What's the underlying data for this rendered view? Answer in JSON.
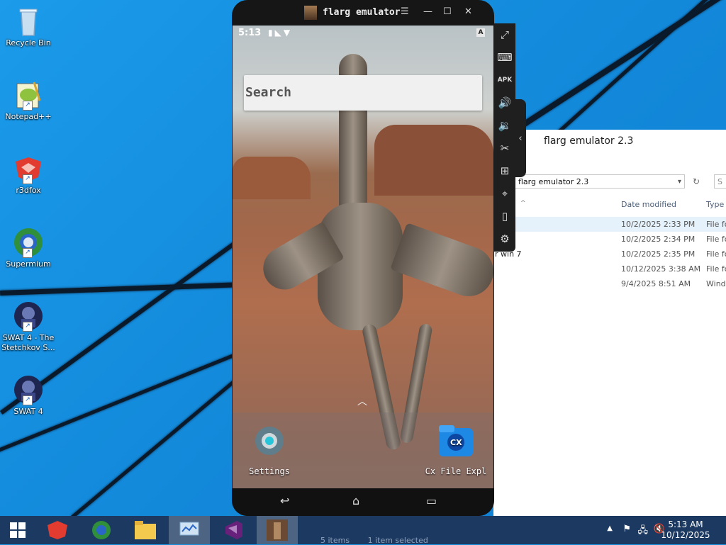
{
  "desktop": {
    "icons": [
      {
        "label": "Recycle Bin"
      },
      {
        "label": "Notepad++"
      },
      {
        "label": "r3dfox"
      },
      {
        "label": "Supermium"
      },
      {
        "label": "SWAT 4 - The Stetchkov S..."
      },
      {
        "label": "SWAT 4"
      }
    ]
  },
  "explorer": {
    "title": "flarg emulator 2.3",
    "address": "flarg emulator 2.3",
    "search_placeholder": "S",
    "columns": {
      "date": "Date modified",
      "type": "Type"
    },
    "rows": [
      {
        "name": "",
        "date": "10/2/2025 2:33 PM",
        "type": "File fo",
        "selected": true
      },
      {
        "name": "",
        "date": "10/2/2025 2:34 PM",
        "type": "File fo",
        "selected": false
      },
      {
        "name": "r win 7",
        "date": "10/2/2025 2:35 PM",
        "type": "File fo",
        "selected": false
      },
      {
        "name": "",
        "date": "10/12/2025 3:38 AM",
        "type": "File fo",
        "selected": false
      },
      {
        "name": "",
        "date": "9/4/2025 8:51 AM",
        "type": "Wind",
        "selected": false
      }
    ],
    "status_items": "5 items",
    "status_selected": "1 item selected"
  },
  "emulator": {
    "title": "flarg emulator",
    "status_time": "5:13",
    "search_label": "Search",
    "apps": [
      {
        "label": "Settings",
        "icon": "settings-gear-icon"
      },
      {
        "label": "Cx File Expl",
        "icon": "cx-file-explorer-icon"
      }
    ],
    "toolbar_icons": [
      "fullscreen-icon",
      "keyboard-icon",
      "apk-install-icon",
      "volume-up-icon",
      "volume-down-icon",
      "screenshot-cut-icon",
      "add-window-icon",
      "location-icon",
      "shake-icon",
      "settings-icon"
    ]
  },
  "taskbar": {
    "time": "5:13 AM",
    "date": "10/12/2025",
    "accent": "#1c3a61"
  }
}
